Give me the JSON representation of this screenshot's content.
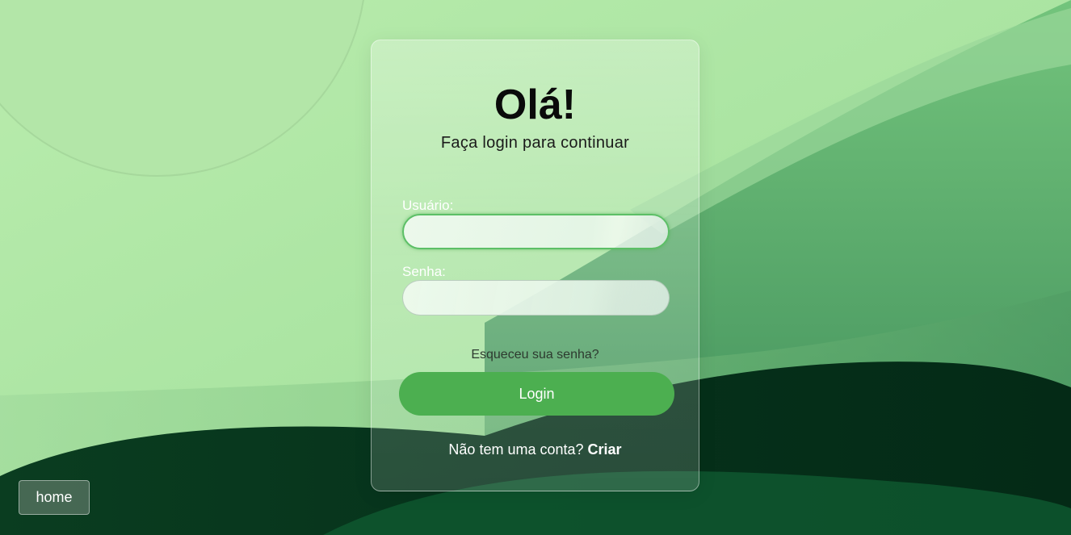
{
  "login": {
    "title": "Olá!",
    "subtitle": "Faça login para continuar",
    "username_label": "Usuário:",
    "username_value": "",
    "password_label": "Senha:",
    "password_value": "",
    "forgot_password": "Esqueceu sua senha?",
    "login_button": "Login",
    "signup_prompt": "Não tem uma conta?",
    "signup_link": "Criar"
  },
  "nav": {
    "home_button": "home"
  },
  "colors": {
    "accent": "#4caf50",
    "background_light": "#b5ebac",
    "background_dark": "#05301a"
  }
}
